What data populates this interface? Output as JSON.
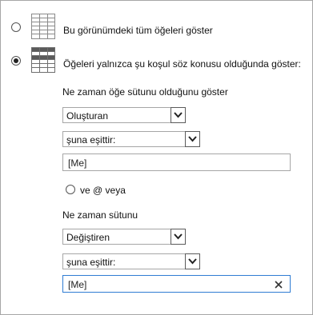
{
  "options": {
    "show_all_label": "Bu görünümdeki tüm öğeleri göster",
    "show_filtered_label": "Öğeleri yalnızca şu koşul söz konusu olduğunda göster:",
    "selected": "show_filtered"
  },
  "condition1": {
    "heading": "Ne zaman öğe sütunu olduğunu göster",
    "column_value": "Oluşturan",
    "operator_value": "şuna eşittir:",
    "input_value": "[Me]"
  },
  "logic": {
    "label": "ve @ veya"
  },
  "condition2": {
    "heading": "Ne zaman sütunu",
    "column_value": "Değiştiren",
    "operator_value": "şuna eşittir:",
    "input_value": "[Me]",
    "clear_icon": "close-icon"
  }
}
